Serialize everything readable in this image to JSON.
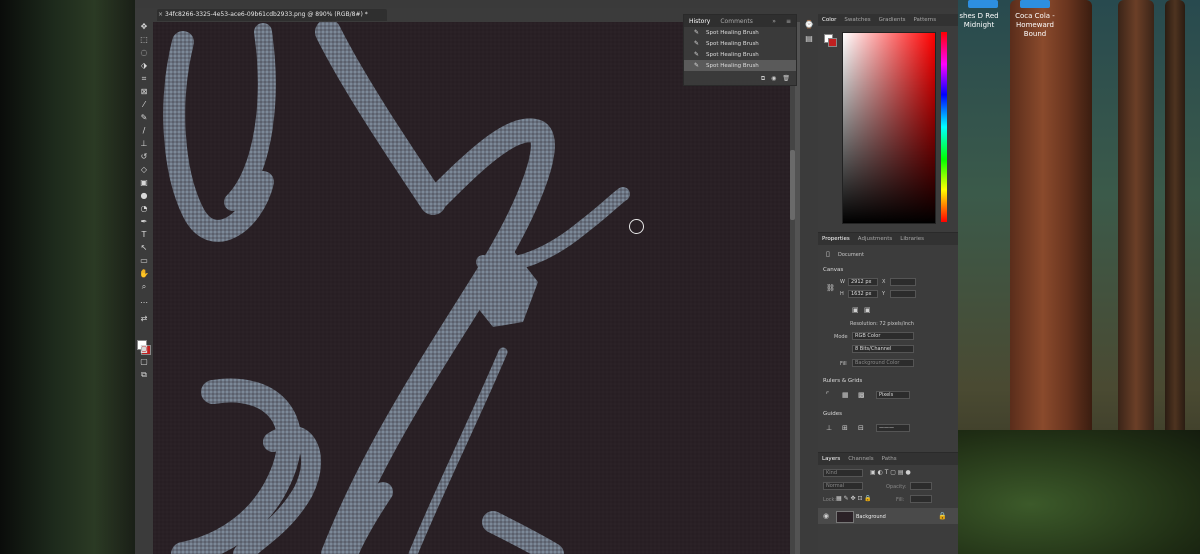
{
  "desktop": {
    "items": [
      {
        "label": "shes D Red Midnight"
      },
      {
        "label": "Coca Cola - Homeward Bound"
      }
    ]
  },
  "document": {
    "tab_title": "34fc8266-3325-4e53-ace6-09b61cdb2933.png @ 890% (RGB/8#) *",
    "close": "×"
  },
  "history_panel": {
    "tabs": [
      "History",
      "Comments"
    ],
    "items": [
      "Spot Healing Brush",
      "Spot Healing Brush",
      "Spot Healing Brush",
      "Spot Healing Brush"
    ],
    "selected_index": 3
  },
  "color_panel": {
    "tabs": [
      "Color",
      "Swatches",
      "Gradients",
      "Patterns"
    ]
  },
  "properties_panel": {
    "tabs": [
      "Properties",
      "Adjustments",
      "Libraries"
    ],
    "doc_label": "Document",
    "canvas_header": "Canvas",
    "w_label": "W",
    "w_value": "2912 px",
    "h_label": "H",
    "h_value": "1632 px",
    "x_label": "X",
    "y_label": "Y",
    "resolution": "Resolution: 72 pixels/inch",
    "mode_label": "Mode",
    "mode_value": "RGB Color",
    "bits_value": "8 Bits/Channel",
    "fill_label": "Fill",
    "fill_value": "Background Color",
    "rulers_header": "Rulers & Grids",
    "units_value": "Pixels",
    "guides_header": "Guides"
  },
  "layers_panel": {
    "tabs": [
      "Layers",
      "Channels",
      "Paths"
    ],
    "kind": "Kind",
    "blend": "Normal",
    "opacity_label": "Opacity:",
    "lock_label": "Lock:",
    "fill_label": "Fill:",
    "layer_name": "Background"
  },
  "colors": {
    "canvas": "#2b2227",
    "script": "#7c8998",
    "panel": "#3c3c3c"
  }
}
